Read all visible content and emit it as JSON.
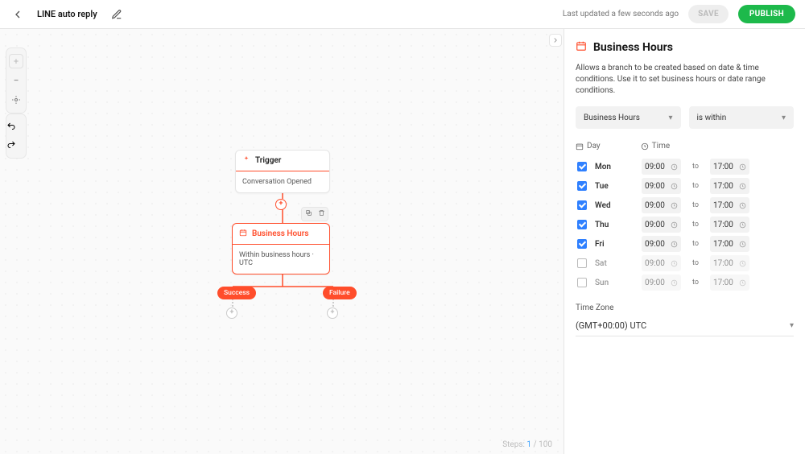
{
  "header": {
    "title": "LINE auto reply",
    "updated": "Last updated a few seconds ago",
    "save": "SAVE",
    "publish": "PUBLISH"
  },
  "canvas": {
    "trigger": {
      "title": "Trigger",
      "body": "Conversation Opened"
    },
    "bh": {
      "title": "Business Hours",
      "body": "Within business hours · UTC"
    },
    "pills": {
      "success": "Success",
      "failure": "Failure"
    },
    "steps": {
      "prefix": "Steps:",
      "current": "1",
      "sep": "/",
      "total": "100"
    }
  },
  "panel": {
    "title": "Business Hours",
    "desc": "Allows a branch to be created based on date & time conditions. Use it to set business hours or date range conditions.",
    "select_type": "Business Hours",
    "select_cond": "is within",
    "columns": {
      "day": "Day",
      "time": "Time"
    },
    "days": [
      {
        "label": "Mon",
        "checked": true,
        "from": "09:00",
        "to": "17:00"
      },
      {
        "label": "Tue",
        "checked": true,
        "from": "09:00",
        "to": "17:00"
      },
      {
        "label": "Wed",
        "checked": true,
        "from": "09:00",
        "to": "17:00"
      },
      {
        "label": "Thu",
        "checked": true,
        "from": "09:00",
        "to": "17:00"
      },
      {
        "label": "Fri",
        "checked": true,
        "from": "09:00",
        "to": "17:00"
      },
      {
        "label": "Sat",
        "checked": false,
        "from": "09:00",
        "to": "17:00"
      },
      {
        "label": "Sun",
        "checked": false,
        "from": "09:00",
        "to": "17:00"
      }
    ],
    "to_label": "to",
    "tz_label": "Time Zone",
    "tz_value": "(GMT+00:00) UTC"
  }
}
